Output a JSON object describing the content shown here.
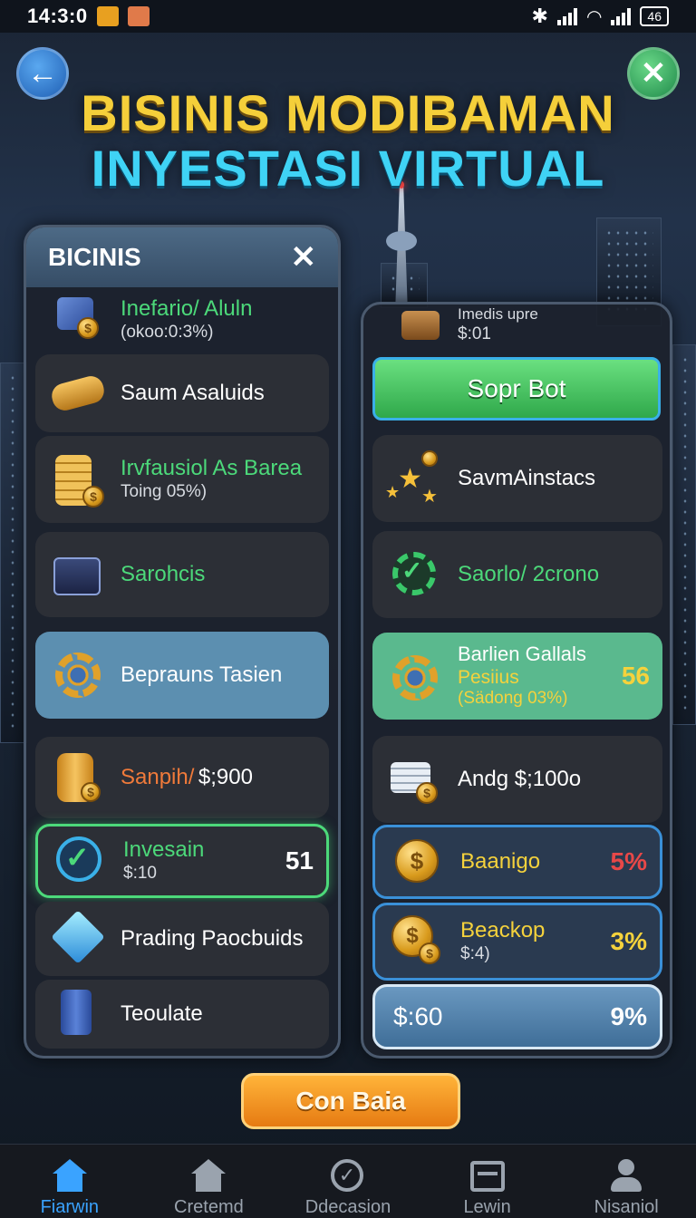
{
  "status_bar": {
    "time": "14:3:0",
    "battery": "46"
  },
  "header": {
    "title_line1": "BISINIS MODIBAMAN",
    "title_line2": "INYESTASI VIRTUAL",
    "back_icon": "arrow-left-icon",
    "close_icon": "close-icon"
  },
  "left_panel": {
    "title": "BICINIS",
    "close_symbol": "✕",
    "items": [
      {
        "label": "Inefario/ Aluln",
        "sub": "(okoo:0:3%)",
        "icon": "shop-coin-icon"
      },
      {
        "label": "Saum Asaluids",
        "sub": "",
        "icon": "coin-stack-icon"
      },
      {
        "label": "Irvfausiol As Barea",
        "sub": "Toing 05%)",
        "icon": "gold-coins-icon"
      },
      {
        "label": "Sarohcis",
        "sub": "",
        "icon": "briefcase-icon"
      },
      {
        "label": "Beprauns Tasien",
        "sub": "",
        "icon": "gear-icon"
      },
      {
        "label": "Sanpih/",
        "label2": "$;900",
        "sub": "",
        "icon": "barrel-icon"
      },
      {
        "label": "Invesain",
        "sub": "$:10",
        "value": "51",
        "icon": "check-gear-icon"
      },
      {
        "label": "Prading Paocbuids",
        "sub": "",
        "icon": "crystal-icon"
      },
      {
        "label": "Teoulate",
        "sub": "",
        "icon": "machine-icon"
      }
    ]
  },
  "right_panel": {
    "top_item": {
      "label": "Imedis upre",
      "sub": "$:01",
      "icon": "crate-icon"
    },
    "action_button": "Sopr Bot",
    "items": [
      {
        "label": "SavmAinstacs",
        "sub": "",
        "icon": "stars-icon"
      },
      {
        "label": "Saorlo/ 2crono",
        "sub": "",
        "icon": "check-gear-icon"
      },
      {
        "label": "Barlien Gallals",
        "label2": "Pesiius",
        "sub": "(Sädong 03%)",
        "value": "56",
        "icon": "gear-check-icon"
      },
      {
        "label": "Andg $;100o",
        "sub": "",
        "icon": "cash-stack-icon"
      },
      {
        "label": "Baanigo",
        "sub": "",
        "value": "5%",
        "icon": "dollar-coin-icon"
      },
      {
        "label": "Beackop",
        "sub": "$:4)",
        "value": "3%",
        "icon": "dollar-coins-icon"
      },
      {
        "label": "$:60",
        "sub": "",
        "value": "9%",
        "icon": ""
      }
    ]
  },
  "bottom_button": "Con Baia",
  "nav": [
    {
      "label": "Fiarwin",
      "icon": "home-icon",
      "active": true
    },
    {
      "label": "Cretemd",
      "icon": "house-icon",
      "active": false
    },
    {
      "label": "Ddecasion",
      "icon": "check-circle-icon",
      "active": false
    },
    {
      "label": "Lewin",
      "icon": "calendar-icon",
      "active": false
    },
    {
      "label": "Nisaniol",
      "icon": "user-icon",
      "active": false
    }
  ],
  "colors": {
    "accent_yellow": "#f5cf3a",
    "accent_cyan": "#3fd3f5",
    "green": "#4cd97a",
    "blue_panel": "#5c8fb0",
    "teal_panel": "#5ab98e"
  }
}
